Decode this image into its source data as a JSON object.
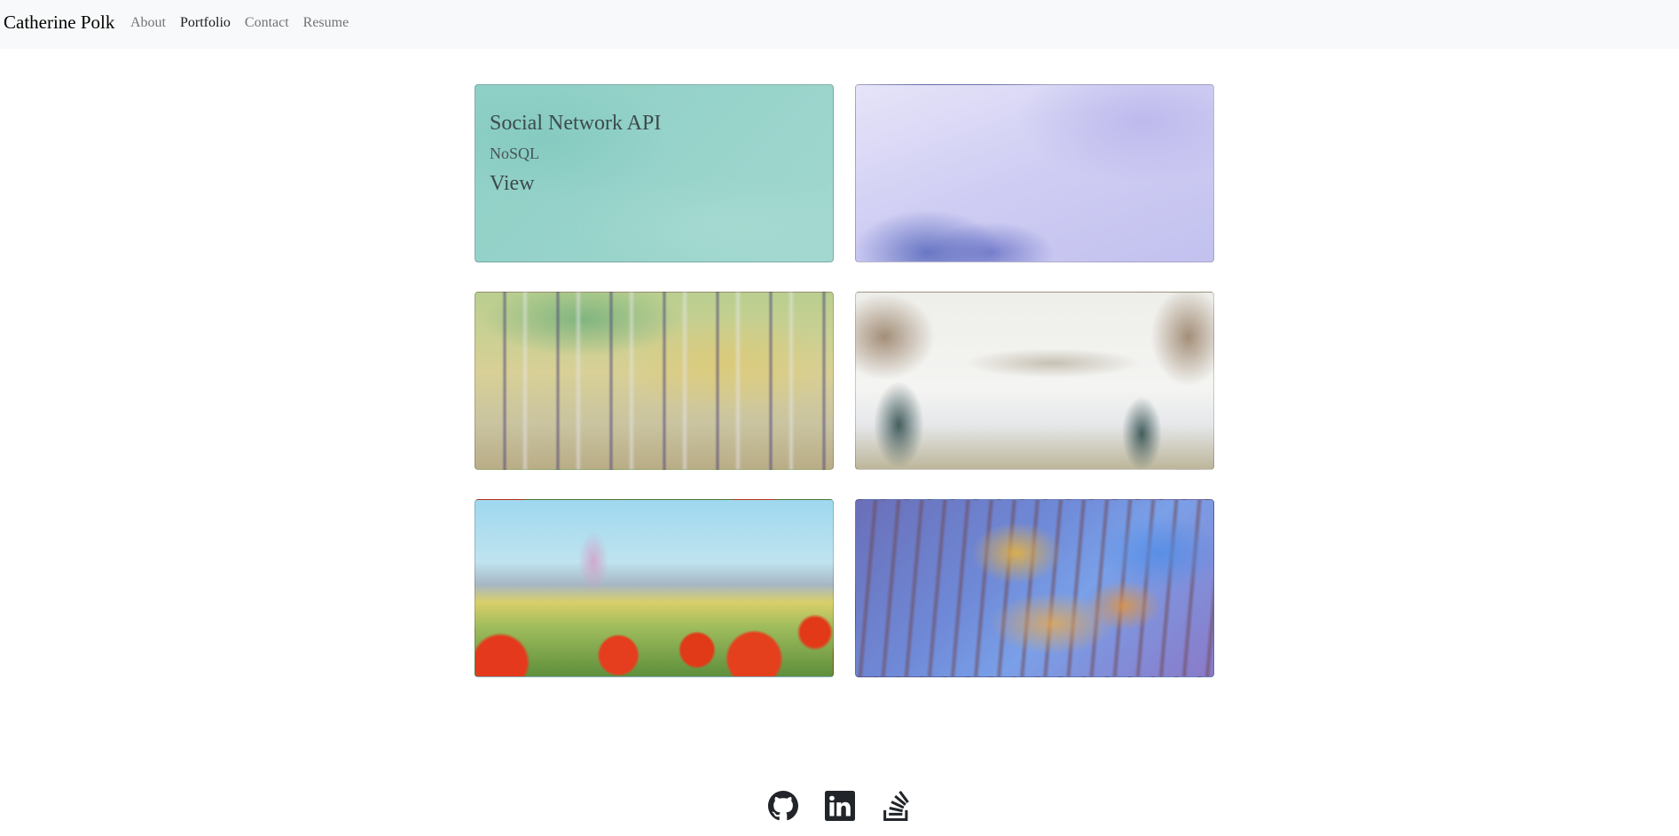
{
  "navbar": {
    "brand": "Catherine Polk",
    "links": [
      {
        "label": "About"
      },
      {
        "label": "Portfolio"
      },
      {
        "label": "Contact"
      },
      {
        "label": "Resume"
      }
    ]
  },
  "portfolio": {
    "cards": [
      {
        "title": "Social Network API",
        "subtitle": "NoSQL",
        "link": "View",
        "background": "teal-watercolor"
      },
      {
        "background": "lavender-watercolor"
      },
      {
        "background": "birch-forest-painting"
      },
      {
        "background": "winter-landscape-watercolor"
      },
      {
        "background": "poppy-field-painting"
      },
      {
        "background": "autumn-forest-painting"
      }
    ]
  },
  "footer": {
    "icons": [
      "github-icon",
      "linkedin-icon",
      "stackoverflow-icon"
    ],
    "icon_color": "#212529"
  },
  "colors": {
    "navbar_bg": "#f8f9fa",
    "card_text": "#3d4a4c"
  }
}
